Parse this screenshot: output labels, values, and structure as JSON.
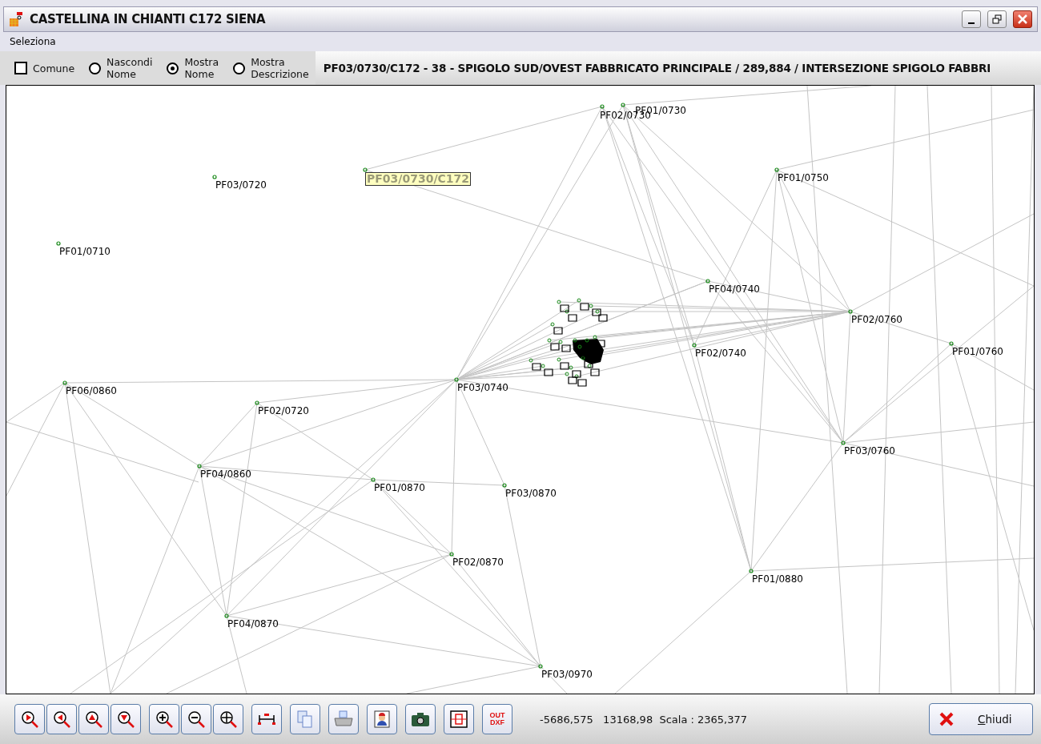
{
  "window": {
    "title": "CASTELLINA IN CHIANTI C172 SIENA"
  },
  "menu": [
    "Seleziona"
  ],
  "options": [
    {
      "kind": "checkbox",
      "lines": [
        "Comune"
      ],
      "checked": false
    },
    {
      "kind": "radio",
      "lines": [
        "Nascondi",
        "Nome"
      ],
      "selected": false
    },
    {
      "kind": "radio",
      "lines": [
        "Mostra",
        "Nome"
      ],
      "selected": true
    },
    {
      "kind": "radio",
      "lines": [
        "Mostra",
        "Descrizione"
      ],
      "selected": false
    }
  ],
  "info": "PF03/0730/C172 - 38 - SPIGOLO SUD/OVEST FABBRICATO PRINCIPALE / 289,884 / INTERSEZIONE SPIGOLO FABBRI",
  "points": [
    {
      "label": "PF02/0730",
      "highlighted": false
    },
    {
      "label": "PF01/0730",
      "highlighted": false
    },
    {
      "label": "PF03/0720",
      "highlighted": false
    },
    {
      "label": "PF03/0730/C172",
      "highlighted": true
    },
    {
      "label": "PF01/0750",
      "highlighted": false
    },
    {
      "label": "PF01/0710",
      "highlighted": false
    },
    {
      "label": "PF04/0740",
      "highlighted": false
    },
    {
      "label": "PF02/0760",
      "highlighted": false
    },
    {
      "label": "PF01/0760",
      "highlighted": false
    },
    {
      "label": "PF02/0740",
      "highlighted": false
    },
    {
      "label": "PF06/0860",
      "highlighted": false
    },
    {
      "label": "PF03/0740",
      "highlighted": false
    },
    {
      "label": "PF02/0720",
      "highlighted": false
    },
    {
      "label": "PF03/0760",
      "highlighted": false
    },
    {
      "label": "PF04/0860",
      "highlighted": false
    },
    {
      "label": "PF01/0870",
      "highlighted": false
    },
    {
      "label": "PF03/0870",
      "highlighted": false
    },
    {
      "label": "PF02/0870",
      "highlighted": false
    },
    {
      "label": "PF01/0880",
      "highlighted": false
    },
    {
      "label": "PF04/0870",
      "highlighted": false
    },
    {
      "label": "PF03/0970",
      "highlighted": false
    }
  ],
  "tool_groups": [
    [
      {
        "kind": "pan-right"
      },
      {
        "kind": "pan-left"
      },
      {
        "kind": "pan-up"
      },
      {
        "kind": "pan-down"
      }
    ],
    [
      {
        "kind": "zoom-in"
      },
      {
        "kind": "zoom-out"
      },
      {
        "kind": "zoom-all"
      }
    ],
    [
      {
        "kind": "measure"
      }
    ],
    [
      {
        "kind": "copy"
      }
    ],
    [
      {
        "kind": "print"
      }
    ],
    [
      {
        "kind": "portrait"
      }
    ],
    [
      {
        "kind": "camera"
      }
    ],
    [
      {
        "kind": "frame"
      }
    ],
    [
      {
        "kind": "dxf",
        "lines": [
          "OUT",
          "DXF"
        ]
      }
    ]
  ],
  "status": "-5686,575   13168,98  Scala : 2365,377",
  "close_button": "Chiudi"
}
